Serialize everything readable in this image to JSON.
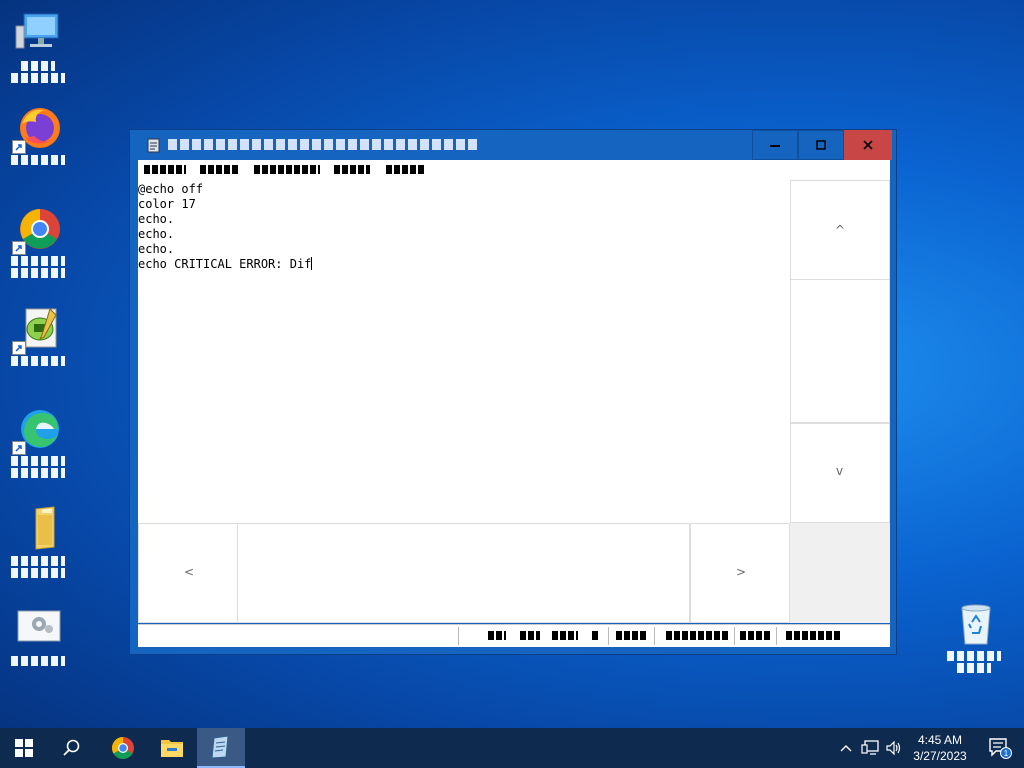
{
  "desktop": {
    "icons": [
      {
        "name": "this-pc",
        "label": ""
      },
      {
        "name": "firefox",
        "label": ""
      },
      {
        "name": "chrome",
        "label": ""
      },
      {
        "name": "notepad-plus-plus",
        "label": ""
      },
      {
        "name": "edge",
        "label": ""
      },
      {
        "name": "folder",
        "label": ""
      },
      {
        "name": "settings",
        "label": ""
      },
      {
        "name": "recycle-bin",
        "label": ""
      }
    ]
  },
  "window": {
    "title": "",
    "menu": [
      "",
      "",
      "",
      "",
      ""
    ],
    "controls": {
      "minimize": "minimize-icon",
      "maximize": "maximize-icon",
      "close": "close-icon"
    },
    "editor": {
      "lines": [
        "@echo off",
        "color 17",
        "echo.",
        "echo.",
        "echo.",
        "echo CRITICAL ERROR: Dif"
      ]
    },
    "scrollbars": {
      "up": "^",
      "down": "v",
      "left": "<",
      "right": ">"
    }
  },
  "taskbar": {
    "items": [
      "start-icon",
      "search-icon",
      "chrome-icon",
      "file-explorer-icon",
      "notepad-icon"
    ],
    "tray": {
      "time": "4:45 AM",
      "date": "3/27/2023",
      "notification_count": "1"
    }
  }
}
